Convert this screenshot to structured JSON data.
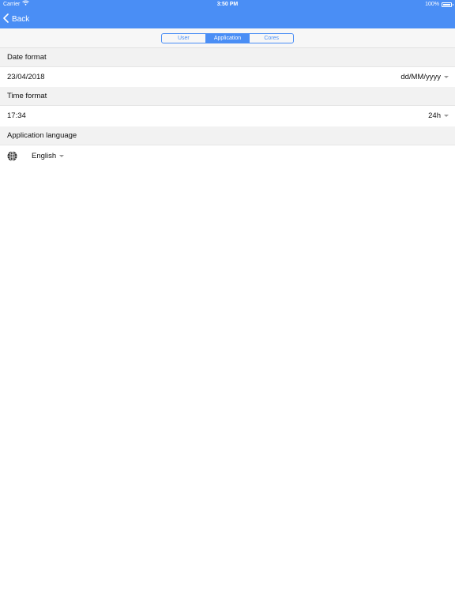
{
  "status_bar": {
    "carrier": "Carrier",
    "time": "3:50 PM",
    "battery": "100%"
  },
  "nav": {
    "back_label": "Back"
  },
  "tabs": [
    {
      "label": "User",
      "active": false
    },
    {
      "label": "Application",
      "active": true
    },
    {
      "label": "Cores",
      "active": false
    }
  ],
  "date_format": {
    "header": "Date format",
    "value": "23/04/2018",
    "selected": "dd/MM/yyyy"
  },
  "time_format": {
    "header": "Time format",
    "value": "17:34",
    "selected": "24h"
  },
  "language": {
    "header": "Application language",
    "selected": "English"
  },
  "colors": {
    "accent": "#4a8ef5",
    "section_bg": "#f2f2f2"
  }
}
